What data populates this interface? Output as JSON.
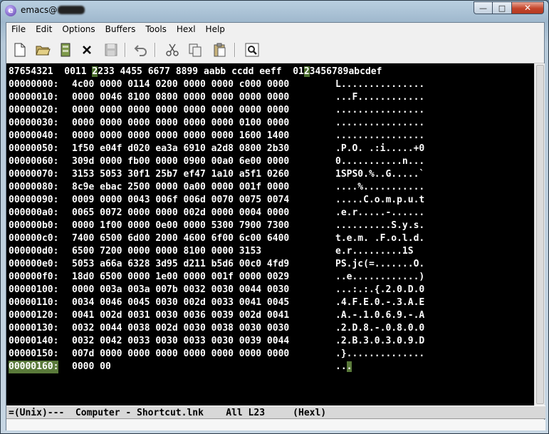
{
  "window": {
    "title_prefix": "emacs@",
    "buttons": {
      "minimize": "—",
      "maximize": "□",
      "close": "✕"
    }
  },
  "menu": [
    "File",
    "Edit",
    "Options",
    "Buffers",
    "Tools",
    "Hexl",
    "Help"
  ],
  "toolbar": {
    "icons": [
      "new-file-icon",
      "open-folder-icon",
      "save-disk-icon",
      "close-x-icon",
      "save-as-icon",
      "undo-icon",
      "cut-icon",
      "copy-icon",
      "paste-icon",
      "search-icon"
    ]
  },
  "hex": {
    "header": {
      "addr": "87654321",
      "hex_a": "0011 ",
      "hex_hl": "2",
      "hex_b": "233 4455 6677 8899 aabb ccdd eeff",
      "asc_a": "01",
      "asc_hl": "2",
      "asc_b": "3456789abcdef"
    },
    "rows": [
      {
        "addr": "00000000:",
        "hex": "4c00 0000 0114 0200 0000 0000 c000 0000",
        "ascii": "L..............."
      },
      {
        "addr": "00000010:",
        "hex": "0000 0046 8100 0800 0000 0000 0000 0000",
        "ascii": "...F............"
      },
      {
        "addr": "00000020:",
        "hex": "0000 0000 0000 0000 0000 0000 0000 0000",
        "ascii": "................"
      },
      {
        "addr": "00000030:",
        "hex": "0000 0000 0000 0000 0000 0000 0100 0000",
        "ascii": "................"
      },
      {
        "addr": "00000040:",
        "hex": "0000 0000 0000 0000 0000 0000 1600 1400",
        "ascii": "................"
      },
      {
        "addr": "00000050:",
        "hex": "1f50 e04f d020 ea3a 6910 a2d8 0800 2b30",
        "ascii": ".P.O. .:i.....+0"
      },
      {
        "addr": "00000060:",
        "hex": "309d 0000 fb00 0000 0900 00a0 6e00 0000",
        "ascii": "0...........n..."
      },
      {
        "addr": "00000070:",
        "hex": "3153 5053 30f1 25b7 ef47 1a10 a5f1 0260",
        "ascii": "1SPS0.%..G.....`"
      },
      {
        "addr": "00000080:",
        "hex": "8c9e ebac 2500 0000 0a00 0000 001f 0000",
        "ascii": "....%..........."
      },
      {
        "addr": "00000090:",
        "hex": "0009 0000 0043 006f 006d 0070 0075 0074",
        "ascii": ".....C.o.m.p.u.t"
      },
      {
        "addr": "000000a0:",
        "hex": "0065 0072 0000 0000 002d 0000 0004 0000",
        "ascii": ".e.r.....-......"
      },
      {
        "addr": "000000b0:",
        "hex": "0000 1f00 0000 0e00 0000 5300 7900 7300",
        "ascii": "..........S.y.s."
      },
      {
        "addr": "000000c0:",
        "hex": "7400 6500 6d00 2000 4600 6f00 6c00 6400",
        "ascii": "t.e.m. .F.o.l.d."
      },
      {
        "addr": "000000d0:",
        "hex": "6500 7200 0000 0000 8100 0000 3153",
        "ascii": "e.r.........1S"
      },
      {
        "addr": "000000e0:",
        "hex": "5053 a66a 6328 3d95 d211 b5d6 00c0 4fd9",
        "ascii": "PS.jc(=.......O."
      },
      {
        "addr": "000000f0:",
        "hex": "18d0 6500 0000 1e00 0000 001f 0000 0029",
        "ascii": "..e............)"
      },
      {
        "addr": "00000100:",
        "hex": "0000 003a 003a 007b 0032 0030 0044 0030",
        "ascii": "...:.:.{.2.0.D.0"
      },
      {
        "addr": "00000110:",
        "hex": "0034 0046 0045 0030 002d 0033 0041 0045",
        "ascii": ".4.F.E.0.-.3.A.E"
      },
      {
        "addr": "00000120:",
        "hex": "0041 002d 0031 0030 0036 0039 002d 0041",
        "ascii": ".A.-.1.0.6.9.-.A"
      },
      {
        "addr": "00000130:",
        "hex": "0032 0044 0038 002d 0030 0038 0030 0030",
        "ascii": ".2.D.8.-.0.8.0.0"
      },
      {
        "addr": "00000140:",
        "hex": "0032 0042 0033 0030 0033 0030 0039 0044",
        "ascii": ".2.B.3.0.3.0.9.D"
      },
      {
        "addr": "00000150:",
        "hex": "007d 0000 0000 0000 0000 0000 0000 0000",
        "ascii": ".}.............."
      }
    ],
    "last_row": {
      "addr": "00000160:",
      "hex": "0000 00",
      "ascii_a": "..",
      "ascii_cursor": "."
    }
  },
  "modeline": "=(Unix)---  Computer - Shortcut.lnk    All L23     (Hexl)"
}
